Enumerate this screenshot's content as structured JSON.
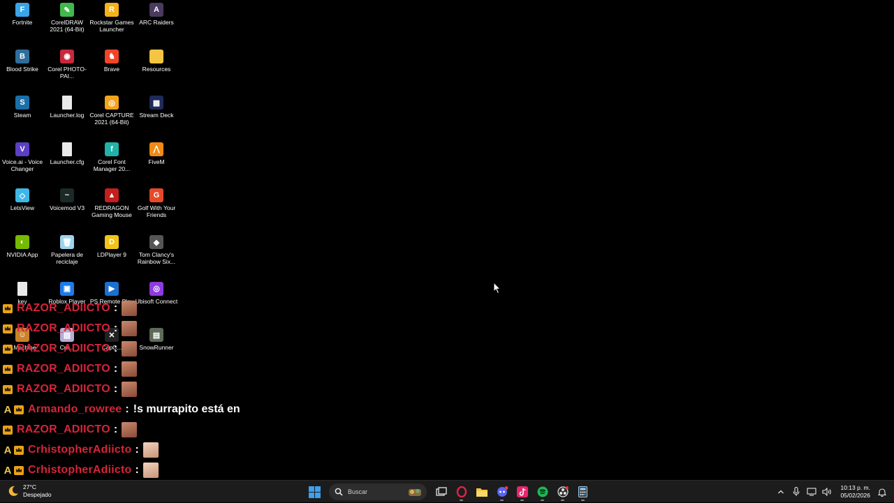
{
  "desktop": {
    "icons": [
      {
        "label": "Fortnite",
        "icon": "fortnite-icon",
        "color": "#3aa4e8",
        "glyph": "F"
      },
      {
        "label": "CorelDRAW 2021 (64-Bit)",
        "icon": "coreldraw-icon",
        "color": "#41b94a",
        "glyph": "✎"
      },
      {
        "label": "Rockstar Games Launcher",
        "icon": "rockstar-icon",
        "color": "#f6b21b",
        "glyph": "R"
      },
      {
        "label": "ARC Raiders",
        "icon": "arc-raiders-icon",
        "color": "#4a3a5e",
        "glyph": "A"
      },
      {
        "label": "Blood Strike",
        "icon": "blood-strike-icon",
        "color": "#2f6e9a",
        "glyph": "B"
      },
      {
        "label": "Corel PHOTO-PAI...",
        "icon": "corel-photopaint-icon",
        "color": "#c8283c",
        "glyph": "◉"
      },
      {
        "label": "Brave",
        "icon": "brave-icon",
        "color": "#f1452a",
        "glyph": "♞"
      },
      {
        "label": "Resources",
        "icon": "folder-icon",
        "color": "#f4c542",
        "glyph": ""
      },
      {
        "label": "Steam",
        "icon": "steam-icon",
        "color": "#1b6fa8",
        "glyph": "S"
      },
      {
        "label": "Launcher.log",
        "icon": "file-icon",
        "color": "#e9e9e9",
        "glyph": ""
      },
      {
        "label": "Corel CAPTURE 2021 (64-Bit)",
        "icon": "corel-capture-icon",
        "color": "#f2a31d",
        "glyph": "◎"
      },
      {
        "label": "Stream Deck",
        "icon": "stream-deck-icon",
        "color": "#1f2a5a",
        "glyph": "▦"
      },
      {
        "label": "Voice.ai - Voice Changer",
        "icon": "voiceai-icon",
        "color": "#5b3fc4",
        "glyph": "V"
      },
      {
        "label": "Launcher.cfg",
        "icon": "file-icon",
        "color": "#e9e9e9",
        "glyph": ""
      },
      {
        "label": "Corel Font Manager 20...",
        "icon": "corel-font-manager-icon",
        "color": "#21b3a8",
        "glyph": "f"
      },
      {
        "label": "FiveM",
        "icon": "fivem-icon",
        "color": "#f08a15",
        "glyph": "⋀"
      },
      {
        "label": "LetsView",
        "icon": "letsview-icon",
        "color": "#3fb7e6",
        "glyph": "◇"
      },
      {
        "label": "Voicemod V3",
        "icon": "voicemod-icon",
        "color": "#1c2a27",
        "glyph": "~"
      },
      {
        "label": "REDRAGON Gaming Mouse",
        "icon": "redragon-icon",
        "color": "#c41f1f",
        "glyph": "▲"
      },
      {
        "label": "Golf With Your Friends",
        "icon": "golf-icon",
        "color": "#e6492a",
        "glyph": "G"
      },
      {
        "label": "NVIDIA App",
        "icon": "nvidia-icon",
        "color": "#76b900",
        "glyph": "◐"
      },
      {
        "label": "Papelera de reciclaje",
        "icon": "recycle-bin-icon",
        "color": "#9fd3ee",
        "glyph": "🗑"
      },
      {
        "label": "LDPlayer 9",
        "icon": "ldplayer-icon",
        "color": "#f2c31b",
        "glyph": "D"
      },
      {
        "label": "Tom Clancy's Rainbow Six...",
        "icon": "rainbow-six-icon",
        "color": "#555555",
        "glyph": "◆"
      },
      {
        "label": "key",
        "icon": "file-icon",
        "color": "#e9e9e9",
        "glyph": ""
      },
      {
        "label": "Roblox Player",
        "icon": "roblox-icon",
        "color": "#1e7be8",
        "glyph": "▣"
      },
      {
        "label": "PS Remote Play",
        "icon": "ps-remote-play-icon",
        "color": "#1b6fd0",
        "glyph": "▶"
      },
      {
        "label": "Ubisoft Connect",
        "icon": "ubisoft-icon",
        "color": "#8d3ce0",
        "glyph": "◎"
      },
      {
        "label": "...Machine",
        "icon": "app-icon",
        "color": "#c9832a",
        "glyph": "☺"
      },
      {
        "label": "Cra...",
        "icon": "app-icon",
        "color": "#b7acd6",
        "glyph": "▧"
      },
      {
        "label": "CapC...",
        "icon": "capcut-icon",
        "color": "#222222",
        "glyph": "✕"
      },
      {
        "label": "SnowRunner",
        "icon": "snowrunner-icon",
        "color": "#5d6a5a",
        "glyph": "▤"
      }
    ]
  },
  "chat": {
    "messages": [
      {
        "badge_a": "",
        "user": "RAZOR_ADIICTO",
        "colon": ":",
        "text": "",
        "emote": "dark"
      },
      {
        "badge_a": "",
        "user": "RAZOR_ADIICTO",
        "colon": ":",
        "text": "",
        "emote": "dark"
      },
      {
        "badge_a": "",
        "user": "RAZOR_ADIICTO",
        "colon": ":",
        "text": "",
        "emote": "dark"
      },
      {
        "badge_a": "",
        "user": "RAZOR_ADIICTO",
        "colon": ":",
        "text": "",
        "emote": "dark"
      },
      {
        "badge_a": "",
        "user": "RAZOR_ADIICTO",
        "colon": ":",
        "text": "",
        "emote": "dark"
      },
      {
        "badge_a": "A",
        "user": "Armando_rowree",
        "colon": ":",
        "text": "!s murrapito está en",
        "emote": ""
      },
      {
        "badge_a": "",
        "user": "RAZOR_ADIICTO",
        "colon": ":",
        "text": "",
        "emote": "dark"
      },
      {
        "badge_a": "A",
        "user": "CrhistopherAdiicto",
        "colon": ":",
        "text": "",
        "emote": "light"
      },
      {
        "badge_a": "A",
        "user": "CrhistopherAdiicto",
        "colon": ":",
        "text": "",
        "emote": "light"
      }
    ]
  },
  "taskbar": {
    "weather": {
      "temp": "27°C",
      "condition": "Despejado"
    },
    "search": {
      "placeholder": "Buscar"
    },
    "apps": [
      {
        "name": "start-button",
        "icon": "windows-icon",
        "running": false
      },
      {
        "name": "task-view-button",
        "icon": "task-view-icon",
        "running": false
      },
      {
        "name": "opera-gx-button",
        "icon": "opera-gx-icon",
        "running": true
      },
      {
        "name": "file-explorer-button",
        "icon": "folder-icon",
        "running": false
      },
      {
        "name": "discord-button",
        "icon": "discord-icon",
        "running": true
      },
      {
        "name": "tiktok-button",
        "icon": "tiktok-icon",
        "running": true
      },
      {
        "name": "spotify-button",
        "icon": "spotify-icon",
        "running": true
      },
      {
        "name": "obs-button",
        "icon": "obs-icon",
        "running": true
      },
      {
        "name": "calculator-button",
        "icon": "calculator-icon",
        "running": true
      }
    ],
    "clock": {
      "time": "10:13 p. m.",
      "date": "05/02/2026"
    },
    "accent": "#0078d4"
  }
}
